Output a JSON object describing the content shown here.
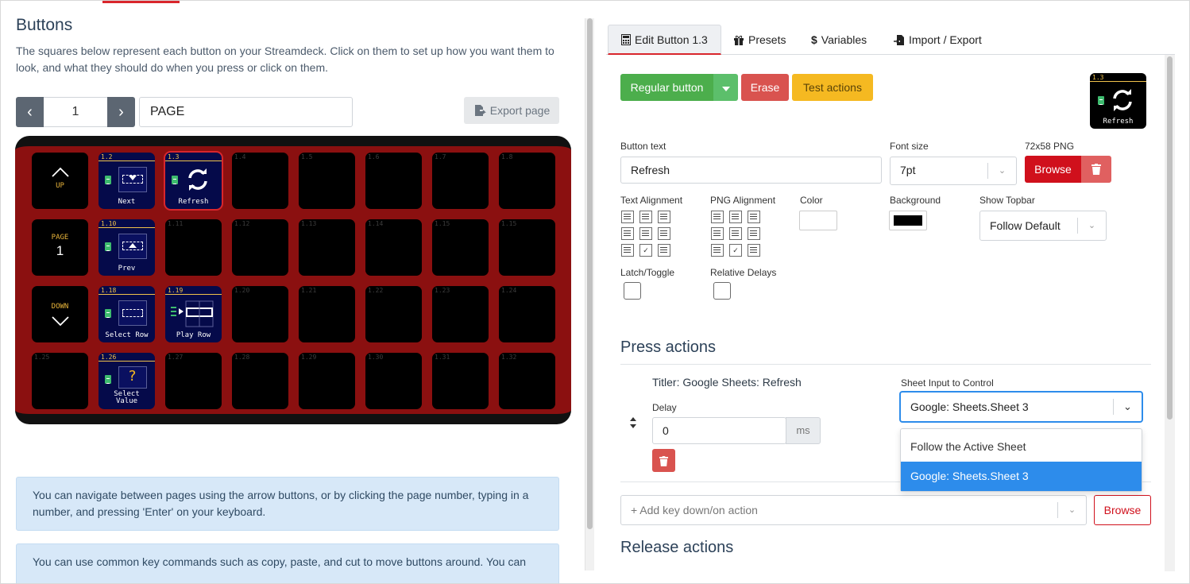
{
  "left": {
    "title": "Buttons",
    "intro": "The squares below represent each button on your Streamdeck. Click on them to set up how you want them to look, and what they should do when you press or click on them.",
    "pager": {
      "prev": "‹",
      "next": "›",
      "page_number": "1",
      "page_name": "PAGE"
    },
    "export_label": "Export page",
    "nav_keys": {
      "up": "UP",
      "page": "PAGE",
      "page_num": "1",
      "down": "DOWN"
    },
    "keys": {
      "row1": [
        "1.2",
        "1.3",
        "1.4",
        "1.5",
        "1.6",
        "1.7",
        "1.8"
      ],
      "row2": [
        "1.10",
        "1.11",
        "1.12",
        "1.13",
        "1.14",
        "1.15",
        "1.15"
      ],
      "row3": [
        "1.18",
        "1.19",
        "1.20",
        "1.21",
        "1.22",
        "1.23",
        "1.24"
      ],
      "row4": [
        "1.25",
        "1.26",
        "1.27",
        "1.28",
        "1.29",
        "1.30",
        "1.31",
        "1.32"
      ]
    },
    "key_labels": {
      "next": "Next",
      "refresh": "Refresh",
      "prev": "Prev",
      "select_row": "Select Row",
      "play_row": "Play Row",
      "select_value_1": "Select",
      "select_value_2": "Value"
    },
    "info1": "You can navigate between pages using the arrow buttons, or by clicking the page number, typing in a number, and pressing 'Enter' on your keyboard.",
    "info2": "You can use common key commands such as copy, paste, and cut to move buttons around. You can"
  },
  "right": {
    "tabs": [
      {
        "label": "Edit Button 1.3",
        "icon": "calculator-icon"
      },
      {
        "label": "Presets",
        "icon": "gift-icon"
      },
      {
        "label": "Variables",
        "icon": "dollar-icon"
      },
      {
        "label": "Import / Export",
        "icon": "file-import-icon"
      }
    ],
    "buttons": {
      "regular": "Regular button",
      "erase": "Erase",
      "test": "Test actions",
      "browse": "Browse",
      "browse2": "Browse"
    },
    "preview": {
      "num": "1.3",
      "label": "Refresh"
    },
    "fields": {
      "button_text_label": "Button text",
      "button_text_value": "Refresh",
      "font_size_label": "Font size",
      "font_size_value": "7pt",
      "png_label": "72x58 PNG",
      "text_align_label": "Text Alignment",
      "png_align_label": "PNG Alignment",
      "color_label": "Color",
      "background_label": "Background",
      "topbar_label": "Show Topbar",
      "topbar_value": "Follow Default",
      "latch_label": "Latch/Toggle",
      "relative_label": "Relative Delays"
    },
    "press_actions": {
      "title": "Press actions",
      "action_name": "Titler: Google Sheets: Refresh",
      "delay_label": "Delay",
      "delay_value": "0",
      "delay_unit": "ms",
      "sheet_label": "Sheet Input to Control",
      "sheet_value": "Google: Sheets.Sheet 3",
      "options": [
        "Follow the Active Sheet",
        "Google: Sheets.Sheet 3"
      ],
      "add_placeholder": "+ Add key down/on action"
    },
    "release_actions": {
      "title": "Release actions"
    },
    "colors": {
      "green": "#4cae4c",
      "red": "#d9534f",
      "amber": "#f5b921",
      "browse_red": "#d0101c",
      "select_blue": "#2d8ceb"
    }
  }
}
